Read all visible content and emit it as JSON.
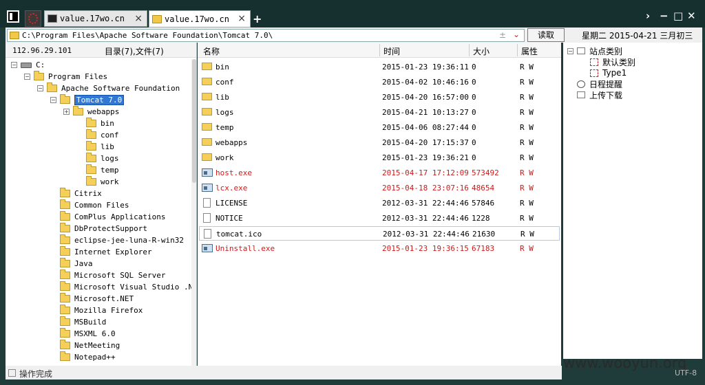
{
  "tabs": [
    {
      "label": "value.17wo.cn",
      "close": "×"
    },
    {
      "label": "value.17wo.cn",
      "close": "×"
    }
  ],
  "new_tab": "+",
  "window_controls": {
    "next": "›",
    "minimize": "−",
    "maximize": "□",
    "close": "✕"
  },
  "address": {
    "path": "C:\\Program Files\\Apache Software Foundation\\Tomcat 7.0\\",
    "pm": "±",
    "dropdown": "⌄"
  },
  "read_button": "读取",
  "date_text": "星期二 2015-04-21 三月初三",
  "left": {
    "ip": "112.96.29.101",
    "dir_count": "目录(7),文件(7)"
  },
  "tree": [
    {
      "label": "C:",
      "exp": "−",
      "type": "drive"
    },
    {
      "label": "Program Files",
      "exp": "−",
      "type": "folder"
    },
    {
      "label": "Apache Software Foundation",
      "exp": "−",
      "type": "folder"
    },
    {
      "label": "Tomcat 7.0",
      "exp": "−",
      "type": "folder",
      "selected": true
    },
    {
      "label": "webapps",
      "exp": "+",
      "type": "folder"
    },
    {
      "label": "bin",
      "exp": "",
      "type": "folder"
    },
    {
      "label": "conf",
      "exp": "",
      "type": "folder"
    },
    {
      "label": "lib",
      "exp": "",
      "type": "folder"
    },
    {
      "label": "logs",
      "exp": "",
      "type": "folder"
    },
    {
      "label": "temp",
      "exp": "",
      "type": "folder"
    },
    {
      "label": "work",
      "exp": "",
      "type": "folder"
    },
    {
      "label": "Citrix",
      "exp": "",
      "type": "folder"
    },
    {
      "label": "Common Files",
      "exp": "",
      "type": "folder"
    },
    {
      "label": "ComPlus Applications",
      "exp": "",
      "type": "folder"
    },
    {
      "label": "DbProtectSupport",
      "exp": "",
      "type": "folder"
    },
    {
      "label": "eclipse-jee-luna-R-win32",
      "exp": "",
      "type": "folder"
    },
    {
      "label": "Internet Explorer",
      "exp": "",
      "type": "folder"
    },
    {
      "label": "Java",
      "exp": "",
      "type": "folder"
    },
    {
      "label": "Microsoft SQL Server",
      "exp": "",
      "type": "folder"
    },
    {
      "label": "Microsoft Visual Studio .NET",
      "exp": "",
      "type": "folder"
    },
    {
      "label": "Microsoft.NET",
      "exp": "",
      "type": "folder"
    },
    {
      "label": "Mozilla Firefox",
      "exp": "",
      "type": "folder"
    },
    {
      "label": "MSBuild",
      "exp": "",
      "type": "folder"
    },
    {
      "label": "MSXML 6.0",
      "exp": "",
      "type": "folder"
    },
    {
      "label": "NetMeeting",
      "exp": "",
      "type": "folder"
    },
    {
      "label": "Notepad++",
      "exp": "",
      "type": "folder"
    }
  ],
  "file_columns": [
    "名称",
    "时间",
    "大小",
    "属性"
  ],
  "files": [
    {
      "name": "bin",
      "time": "2015-01-23 19:36:11",
      "size": "0",
      "attr": "R W",
      "type": "folder",
      "red": false
    },
    {
      "name": "conf",
      "time": "2015-04-02 10:46:16",
      "size": "0",
      "attr": "R W",
      "type": "folder",
      "red": false
    },
    {
      "name": "lib",
      "time": "2015-04-20 16:57:00",
      "size": "0",
      "attr": "R W",
      "type": "folder",
      "red": false
    },
    {
      "name": "logs",
      "time": "2015-04-21 10:13:27",
      "size": "0",
      "attr": "R W",
      "type": "folder",
      "red": false
    },
    {
      "name": "temp",
      "time": "2015-04-06 08:27:44",
      "size": "0",
      "attr": "R W",
      "type": "folder",
      "red": false
    },
    {
      "name": "webapps",
      "time": "2015-04-20 17:15:37",
      "size": "0",
      "attr": "R W",
      "type": "folder",
      "red": false
    },
    {
      "name": "work",
      "time": "2015-01-23 19:36:21",
      "size": "0",
      "attr": "R W",
      "type": "folder",
      "red": false
    },
    {
      "name": "host.exe",
      "time": "2015-04-17 17:12:09",
      "size": "573492",
      "attr": "R W",
      "type": "exe",
      "red": true
    },
    {
      "name": "lcx.exe",
      "time": "2015-04-18 23:07:16",
      "size": "48654",
      "attr": "R W",
      "type": "exe",
      "red": true
    },
    {
      "name": "LICENSE",
      "time": "2012-03-31 22:44:46",
      "size": "57846",
      "attr": "R W",
      "type": "doc",
      "red": false
    },
    {
      "name": "NOTICE",
      "time": "2012-03-31 22:44:46",
      "size": "1228",
      "attr": "R W",
      "type": "doc",
      "red": false
    },
    {
      "name": "tomcat.ico",
      "time": "2012-03-31 22:44:46",
      "size": "21630",
      "attr": "R W",
      "type": "doc",
      "red": false,
      "highlight": true
    },
    {
      "name": "Uninstall.exe",
      "time": "2015-01-23 19:36:15",
      "size": "67183",
      "attr": "R W",
      "type": "exe",
      "red": true
    }
  ],
  "right_tree": [
    {
      "label": "站点类别",
      "exp": "−",
      "icon": "box"
    },
    {
      "label": "默认类别",
      "exp": "",
      "icon": "cat"
    },
    {
      "label": "Type1",
      "exp": "",
      "icon": "cat"
    },
    {
      "label": "日程提醒",
      "exp": "",
      "icon": "cal"
    },
    {
      "label": "上传下载",
      "exp": "",
      "icon": "box"
    }
  ],
  "status": "操作完成",
  "watermark": "www.wooyun.org",
  "encoding": "UTF-8",
  "colors": {
    "red_text": "#d01818",
    "selection": "#3177d4",
    "frame": "#1f3b3a"
  }
}
